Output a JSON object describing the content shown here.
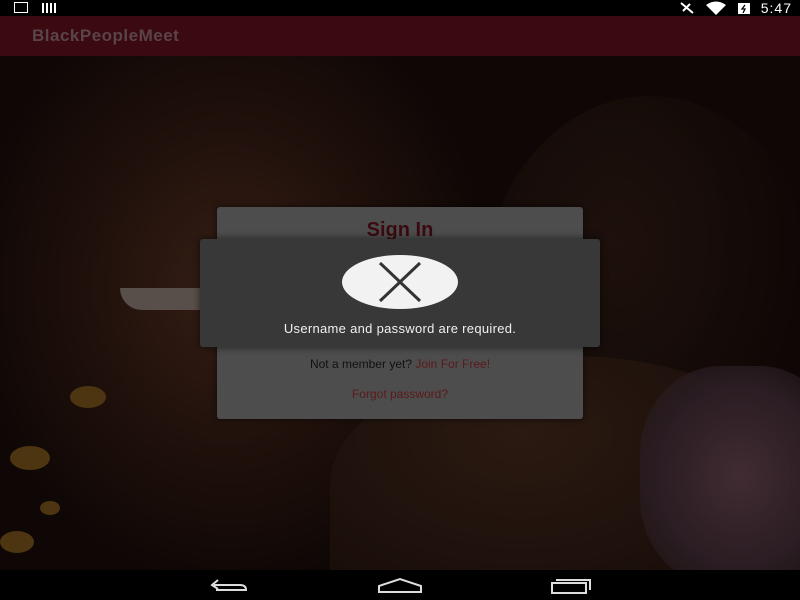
{
  "status_bar": {
    "time": "5:47",
    "icons": [
      "download-icon",
      "signal-bars-icon",
      "vibrate-icon",
      "wifi-icon",
      "battery-icon"
    ]
  },
  "app_bar": {
    "title": "BlackPeopleMeet"
  },
  "signin_card": {
    "title": "Sign In",
    "not_member_text": "Not a member yet?",
    "join_link": "Join For Free!",
    "forgot_link": "Forgot password?"
  },
  "error_dialog": {
    "icon": "close-x-icon",
    "message": "Username and password are required."
  },
  "nav_bar": {
    "buttons": [
      "back-icon",
      "home-icon",
      "recents-icon"
    ]
  },
  "colors": {
    "app_bar": "#3a0a10",
    "card": "#4d4d4d",
    "dialog": "#383838",
    "link": "#5a1a1a"
  }
}
